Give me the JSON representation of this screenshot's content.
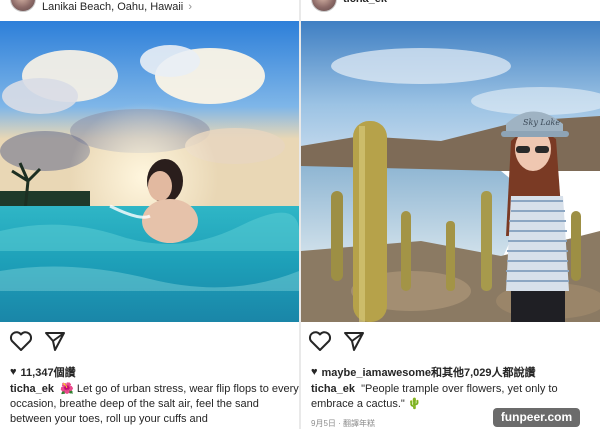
{
  "posts": [
    {
      "location": "Lanikai Beach, Oahu, Hawaii",
      "location_chevron": "›",
      "likes_text": "11,347個讚",
      "caption_user": "ticha_ek",
      "caption_emoji": "🌺",
      "caption_text": "Let go of urban stress, wear flip flops to every occasion, breathe deep of the salt air, feel the sand between your toes, roll up your cuffs and"
    },
    {
      "username": "ticha_ek",
      "likes_text": "maybe_iamawesome和其他7,029人都說讚",
      "caption_user": "ticha_ek",
      "caption_text": "\"People trample over flowers, yet only to embrace a cactus.\"",
      "caption_emoji": "🌵",
      "date_text": "9月5日 · 翻譯年糕",
      "cap_text": "Sky Lake"
    }
  ],
  "icons": [
    "heart-icon",
    "share-icon",
    "small-heart-icon",
    "chevron-right-icon"
  ],
  "watermark": "funpeer.com",
  "colors": {
    "text": "#262626",
    "muted": "#8e8e8e",
    "watermark_bg": "#6b6b6b"
  }
}
